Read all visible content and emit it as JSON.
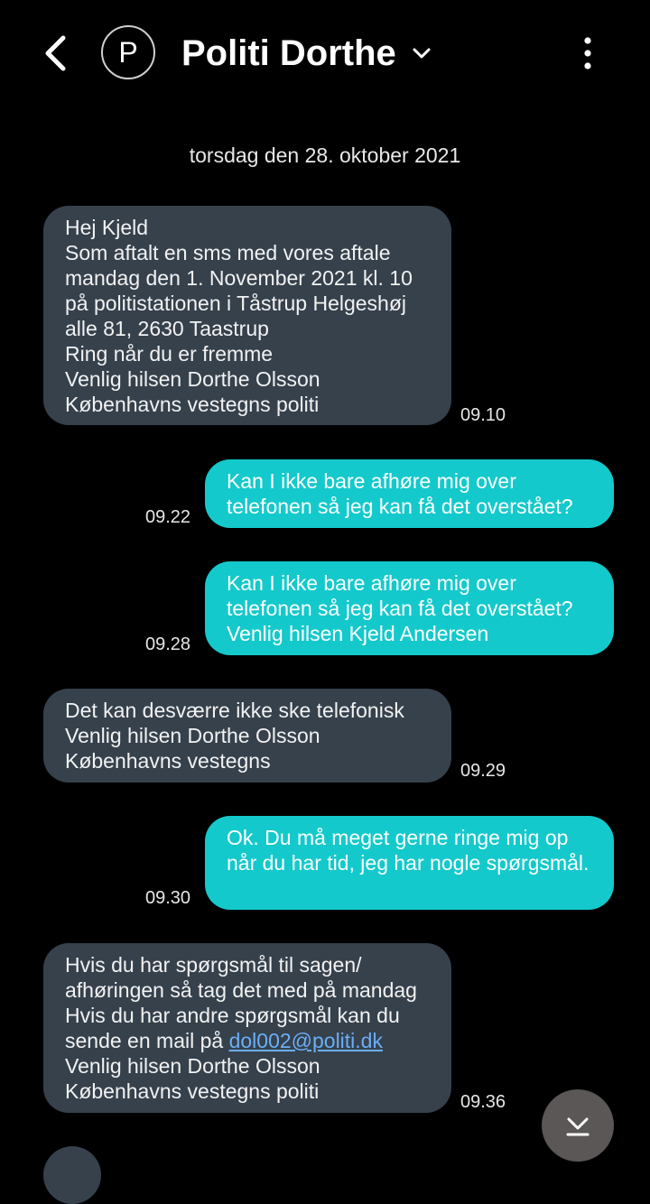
{
  "header": {
    "avatar_letter": "P",
    "contact_name": "Politi Dorthe",
    "back_icon": "back-arrow-icon",
    "chevron_icon": "chevron-down-icon",
    "more_icon": "more-vertical-icon"
  },
  "date_separator": "torsdag den 28. oktober 2021",
  "messages": [
    {
      "direction": "incoming",
      "text": "Hej Kjeld\nSom aftalt en sms med vores aftale mandag den 1. November 2021 kl. 10 på politistationen i Tåstrup Helgeshøj alle 81, 2630 Taastrup\nRing når du er fremme\nVenlig hilsen Dorthe Olsson\nKøbenhavns vestegns politi",
      "time": "09.10"
    },
    {
      "direction": "outgoing",
      "text": "Kan I ikke bare afhøre mig over telefonen så jeg kan få det overstået?",
      "time": "09.22"
    },
    {
      "direction": "outgoing",
      "text": "Kan I ikke bare afhøre mig over telefonen så jeg kan få det overstået?\nVenlig hilsen Kjeld Andersen",
      "time": "09.28"
    },
    {
      "direction": "incoming",
      "text": "Det kan desværre ikke ske telefonisk\nVenlig hilsen Dorthe Olsson\nKøbenhavns vestegns",
      "time": "09.29"
    },
    {
      "direction": "outgoing",
      "text": "Ok. Du må meget gerne ringe mig op når du har tid, jeg har nogle spørgsmål.",
      "time": "09.30"
    },
    {
      "direction": "incoming",
      "text_before_link": "Hvis du har spørgsmål til sagen/\nafhøringen så tag det med på mandag\nHvis du har andre spørgsmål kan du sende en mail på ",
      "link": "dol002@politi.dk",
      "text_after_link": "\nVenlig hilsen Dorthe Olsson\nKøbenhavns vestegns politi",
      "time": "09.36"
    }
  ],
  "scroll_button_icon": "scroll-down-icon",
  "colors": {
    "background": "#000000",
    "incoming_bubble": "#36414c",
    "outgoing_bubble": "#14c9cb",
    "link": "#6aaef7",
    "scroll_button": "#5a5756"
  }
}
